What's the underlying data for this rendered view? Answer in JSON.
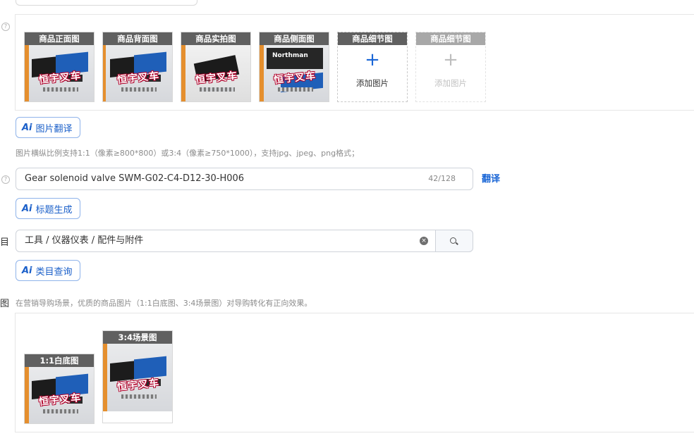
{
  "product_images": {
    "slots": [
      {
        "caption": "商品正面图",
        "watermark": "恒宇叉车"
      },
      {
        "caption": "商品背面图",
        "watermark": "恒宇叉车"
      },
      {
        "caption": "商品实拍图",
        "watermark": "恒宇叉车"
      },
      {
        "caption": "商品侧面图",
        "watermark": "恒宇叉车",
        "brand": "Northman"
      }
    ],
    "add_slots": [
      {
        "caption": "商品细节图",
        "plus": "+",
        "label": "添加图片",
        "enabled": true
      },
      {
        "caption": "商品细节图",
        "plus": "+",
        "label": "添加图片",
        "enabled": false
      }
    ],
    "translate_button": "图片翻译",
    "hint": "图片横纵比例支持1:1（像素≥800*800）或3:4（像素≥750*1000），支持jpg、jpeg、png格式；"
  },
  "title": {
    "value": "Gear solenoid valve SWM-G02-C4-D12-30-H006",
    "count": "42/128",
    "translate_link": "翻译",
    "generate_button": "标题生成"
  },
  "category": {
    "side_label": "目",
    "value": "工具 / 仪器仪表 / 配件与附件",
    "clear_icon": "×",
    "query_button": "类目查询"
  },
  "marketing": {
    "side_label": "图",
    "hint": "在营销导购场景，优质的商品图片（1:1白底图、3:4场景图）对导购转化有正向效果。",
    "images": [
      {
        "caption": "1:1白底图",
        "watermark": "恒宇叉车"
      },
      {
        "caption": "3:4场景图",
        "watermark": "恒宇叉车"
      }
    ]
  },
  "ai_icon_text": "Ai",
  "help_icon_text": "?"
}
